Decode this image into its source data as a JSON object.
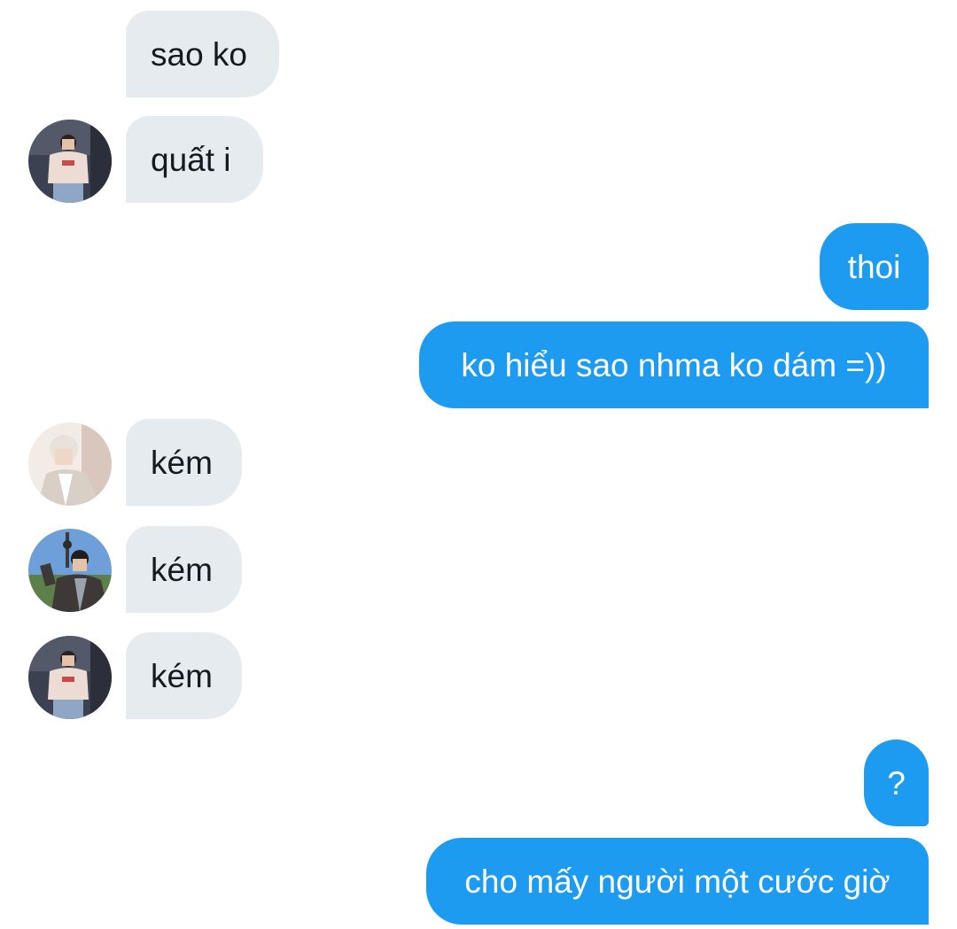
{
  "messages": [
    {
      "text": "sao ko",
      "sender": "other",
      "avatar": "none"
    },
    {
      "text": "quất i",
      "sender": "other",
      "avatar": "user-a"
    },
    {
      "text": "thoi",
      "sender": "me"
    },
    {
      "text": "ko hiểu sao nhma ko dám =))",
      "sender": "me"
    },
    {
      "text": "kém",
      "sender": "other",
      "avatar": "user-b"
    },
    {
      "text": "kém",
      "sender": "other",
      "avatar": "user-c"
    },
    {
      "text": "kém",
      "sender": "other",
      "avatar": "user-a"
    },
    {
      "text": "?",
      "sender": "me"
    },
    {
      "text": "cho mấy người một cước giờ",
      "sender": "me"
    }
  ],
  "colors": {
    "incoming_bubble": "#e6ebf0",
    "outgoing_bubble": "#1d9bf0",
    "incoming_text": "#141a1f",
    "outgoing_text": "#ffffff"
  }
}
